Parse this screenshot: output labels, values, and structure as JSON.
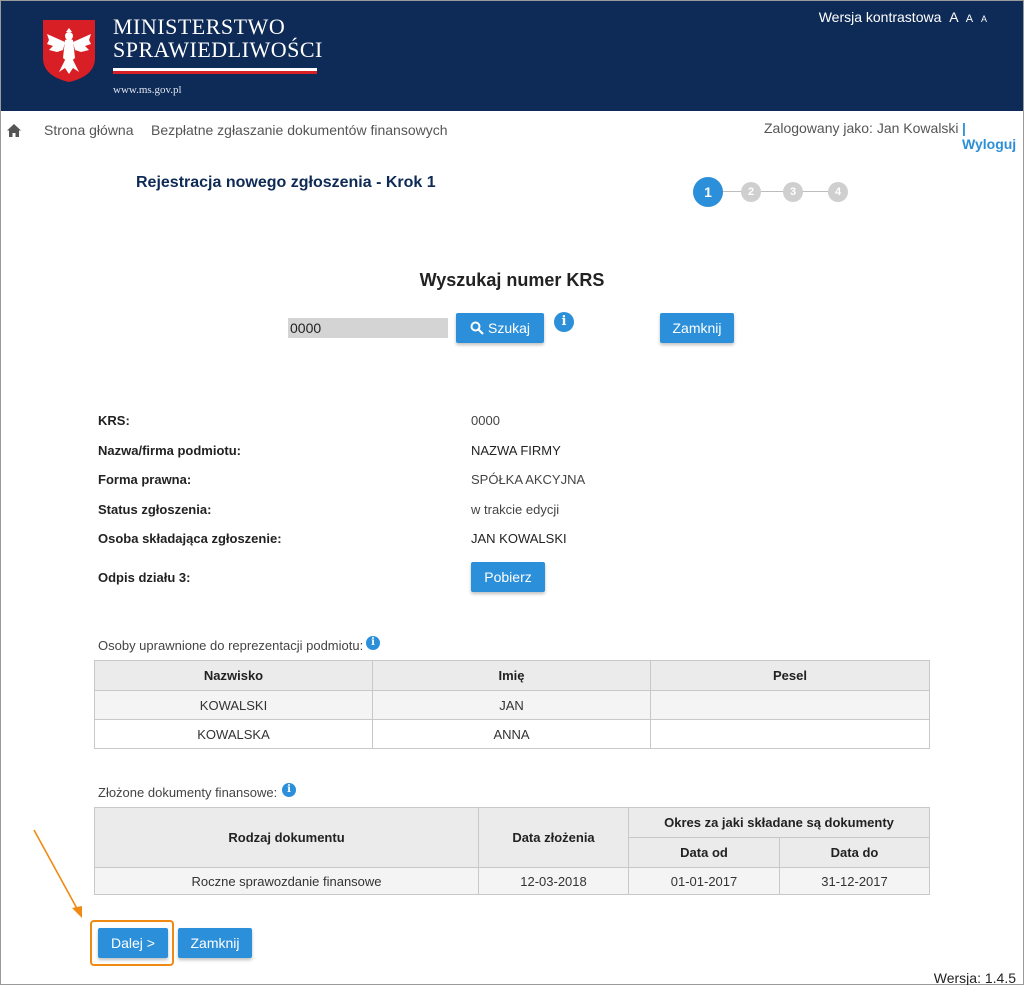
{
  "header": {
    "brand_line1": "MINISTERSTWO",
    "brand_line2": "SPRAWIEDLIWOŚCI",
    "brand_url": "www.ms.gov.pl",
    "contrast_label": "Wersja kontrastowa",
    "font_sizes": [
      "A",
      "A",
      "A"
    ]
  },
  "nav": {
    "home_icon": "home-icon",
    "home": "Strona główna",
    "section": "Bezpłatne zgłaszanie dokumentów finansowych",
    "user": "Zalogowany jako: Jan Kowalski",
    "logout": "| Wyloguj"
  },
  "page_title": "Rejestracja nowego zgłoszenia - Krok 1",
  "stepper": {
    "steps": [
      "1",
      "2",
      "3",
      "4"
    ],
    "active": 1
  },
  "search": {
    "heading": "Wyszukaj numer KRS",
    "input_value": "0000",
    "search_button": "Szukaj",
    "close_button": "Zamknij",
    "info": "i"
  },
  "details": [
    {
      "label": "KRS:",
      "value": "0000"
    },
    {
      "label": "Nazwa/firma podmiotu:",
      "value": "NAZWA FIRMY"
    },
    {
      "label": "Forma prawna:",
      "value": "SPÓŁKA AKCYJNA"
    },
    {
      "label": "Status zgłoszenia:",
      "value": "w trakcie edycji"
    },
    {
      "label": "Osoba składająca zgłoszenie:",
      "value": "JAN KOWALSKI"
    },
    {
      "label": "Odpis działu 3:",
      "button": "Pobierz"
    }
  ],
  "representatives": {
    "label": "Osoby uprawnione do reprezentacji podmiotu:",
    "headers": [
      "Nazwisko",
      "Imię",
      "Pesel"
    ],
    "rows": [
      [
        "KOWALSKI",
        "JAN",
        ""
      ],
      [
        "KOWALSKA",
        "ANNA",
        ""
      ]
    ]
  },
  "documents": {
    "label": "Złożone dokumenty finansowe:",
    "headers": {
      "type": "Rodzaj dokumentu",
      "date": "Data złożenia",
      "period": "Okres za jaki składane są dokumenty",
      "from": "Data od",
      "to": "Data do"
    },
    "rows": [
      [
        "Roczne sprawozdanie finansowe",
        "12-03-2018",
        "01-01-2017",
        "31-12-2017"
      ]
    ]
  },
  "footer": {
    "next_button": "Dalej >",
    "close_button": "Zamknij",
    "version": "Wersja: 1.4.5"
  },
  "colors": {
    "header_bg": "#0e2a56",
    "accent": "#2c8fd9",
    "highlight": "#f08a12"
  }
}
